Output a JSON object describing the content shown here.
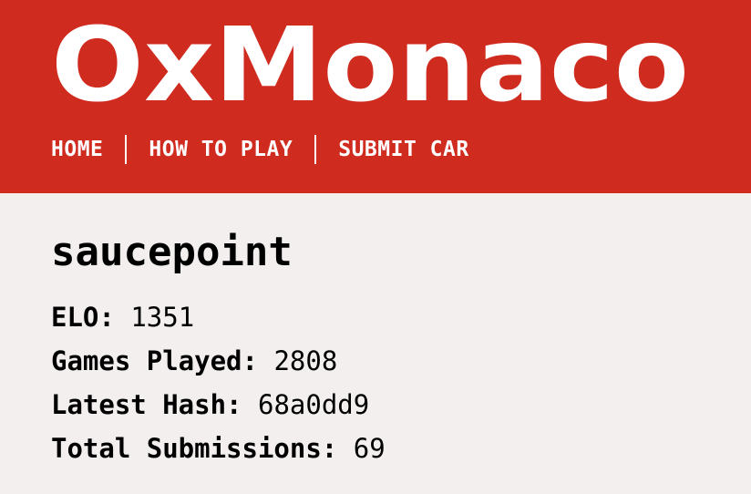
{
  "header": {
    "logo_text": "OxMonaco",
    "background_color": "#d02b1f",
    "logo_color": "#ffffff"
  },
  "nav": {
    "items": [
      {
        "label": "HOME"
      },
      {
        "label": "HOW TO PLAY"
      },
      {
        "label": "SUBMIT CAR"
      }
    ]
  },
  "profile": {
    "username": "saucepoint",
    "stats": [
      {
        "label": "ELO:",
        "value": "1351"
      },
      {
        "label": "Games Played:",
        "value": "2808"
      },
      {
        "label": "Latest Hash:",
        "value": "68a0dd9"
      },
      {
        "label": "Total Submissions:",
        "value": "69"
      }
    ]
  }
}
